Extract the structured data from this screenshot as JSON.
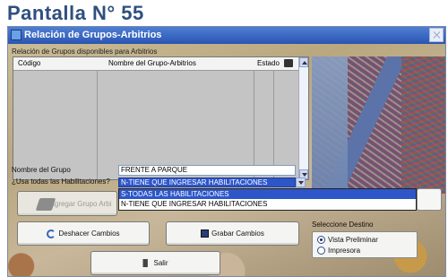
{
  "page_heading": "Pantalla  N° 55",
  "window": {
    "title": "Relación de Grupos-Arbitrios"
  },
  "groups_panel": {
    "label": "Relación de Grupos disponibles para Arbitrios",
    "columns": {
      "code": "Código",
      "name": "Nombre del Grupo-Arbitrios",
      "status": "Estado"
    }
  },
  "form": {
    "group_name_label": "Nombre del Grupo",
    "group_name_value": "FRENTE A PARQUE",
    "use_all_label": "¿Usa todas las Habilitaciones?",
    "use_all_selected": "N-TIENE QUE INGRESAR HABILITACIONES",
    "use_all_options": [
      "S-TODAS LAS HABILITACIONES",
      "N-TIENE QUE INGRESAR HABILITACIONES"
    ]
  },
  "buttons": {
    "add_group": "Agregar Grupo Arbi",
    "undo": "Deshacer Cambios",
    "save": "Grabar Cambios",
    "exit": "Salir"
  },
  "destination": {
    "label": "Seleccione Destino",
    "options": [
      "Vista Preliminar",
      "Impresora"
    ],
    "selected": "Vista Preliminar"
  },
  "icons": {
    "window": "window-icon",
    "close": "close-icon",
    "printer": "printer-icon",
    "undo": "undo-icon",
    "save": "save-icon",
    "exit": "exit-icon",
    "book": "book-icon"
  },
  "colors": {
    "title_bar": "#2a55b2",
    "selection": "#2d56c9",
    "heading_text": "#2f4f7f"
  }
}
